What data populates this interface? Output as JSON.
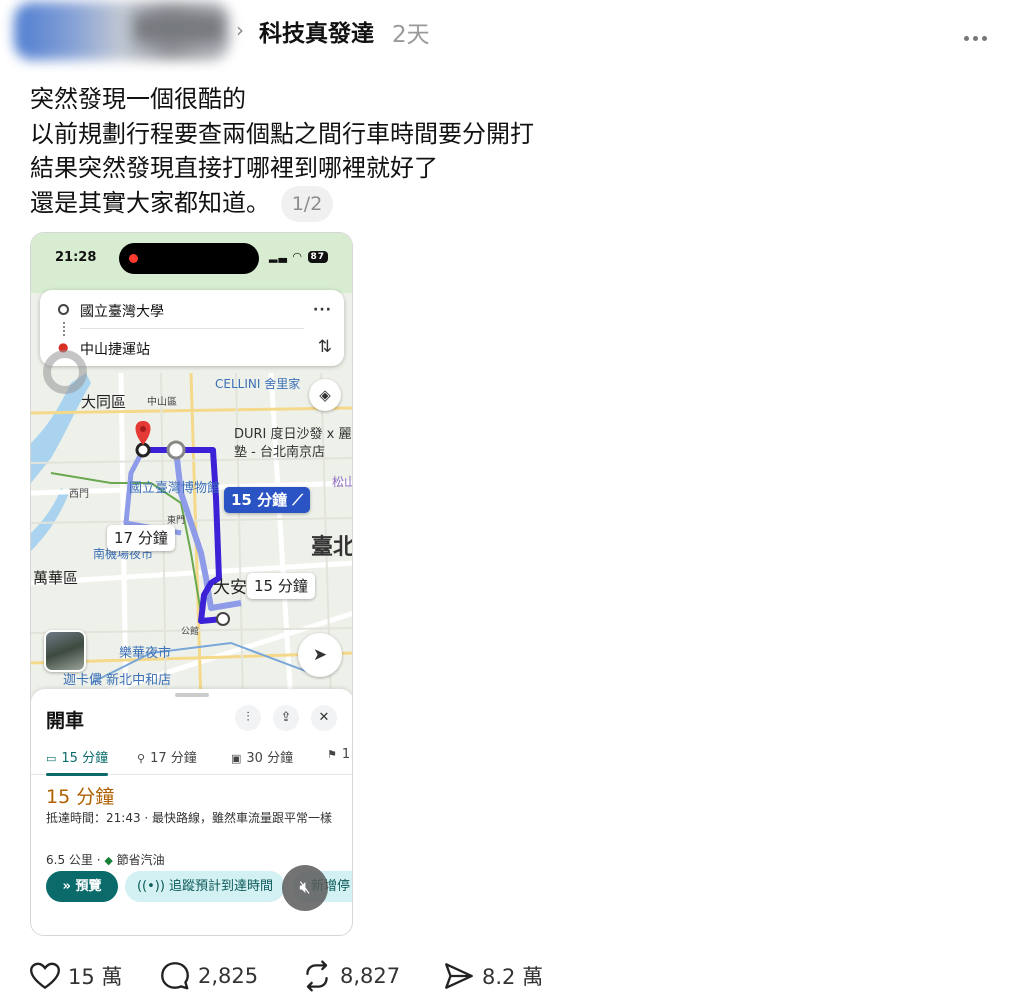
{
  "post": {
    "source_name": "科技真發達",
    "time_ago": "2天",
    "text_lines": [
      "突然發現一個很酷的",
      "以前規劃行程要查兩個點之間行車時間要分開打",
      "結果突然發現直接打哪裡到哪裡就好了",
      "還是其實大家都知道。"
    ],
    "image_pager": "1/2"
  },
  "phone": {
    "status_time": "21:28",
    "battery": "87",
    "route": {
      "origin": "國立臺灣大學",
      "destination": "中山捷運站"
    },
    "map_labels": {
      "cellini": "CELLINI 舍里家",
      "datong": "大同區",
      "zhongshan_dist": "中山區",
      "duri_1": "DURI 度日沙發 x 麗",
      "duri_2": "塾 - 台北南京店",
      "museum": "國立臺灣博物館",
      "taipei": "臺北",
      "daan": "大安",
      "nanjichang": "南機場夜市",
      "wanhua": "萬華區",
      "lehua": "樂華夜市",
      "carrefour": "迦卡儂 新北中和店",
      "ximen": "西門",
      "dongmen": "東門",
      "gongguan": "公館",
      "songshan": "松山",
      "zhongshan_small": "中山區"
    },
    "map_chips": {
      "primary": "15 分鐘",
      "alt_1": "17 分鐘",
      "alt_2": "15 分鐘"
    },
    "sheet": {
      "title": "開車",
      "tabs": [
        "15 分鐘",
        "17 分鐘",
        "30 分鐘",
        "1"
      ],
      "eta_big": "15 分鐘",
      "eta_detail": "抵達時間：21:43 · 最快路線，雖然車流量跟平常一樣",
      "distance": "6.5 公里",
      "fuel": "節省汽油",
      "preview_label": "預覽",
      "track_label": "追蹤預計到達時間",
      "add_label": "新增停"
    }
  },
  "actions": {
    "likes": "15 萬",
    "comments": "2,825",
    "reposts": "8,827",
    "shares": "8.2 萬"
  },
  "colors": {
    "route_primary": "#3b22d6",
    "route_alt": "#8e9be8",
    "accent_teal": "#0b6b6b",
    "eta_orange": "#b06000"
  },
  "icons": [
    "chevron-right-icon",
    "more-icon",
    "layers-icon",
    "locate-icon",
    "swap-icon",
    "car-icon",
    "motorcycle-icon",
    "transit-icon",
    "walk-icon",
    "filter-icon",
    "share-icon",
    "close-icon",
    "leaf-icon",
    "mute-icon",
    "heart-icon",
    "comment-icon",
    "repost-icon",
    "send-icon"
  ]
}
